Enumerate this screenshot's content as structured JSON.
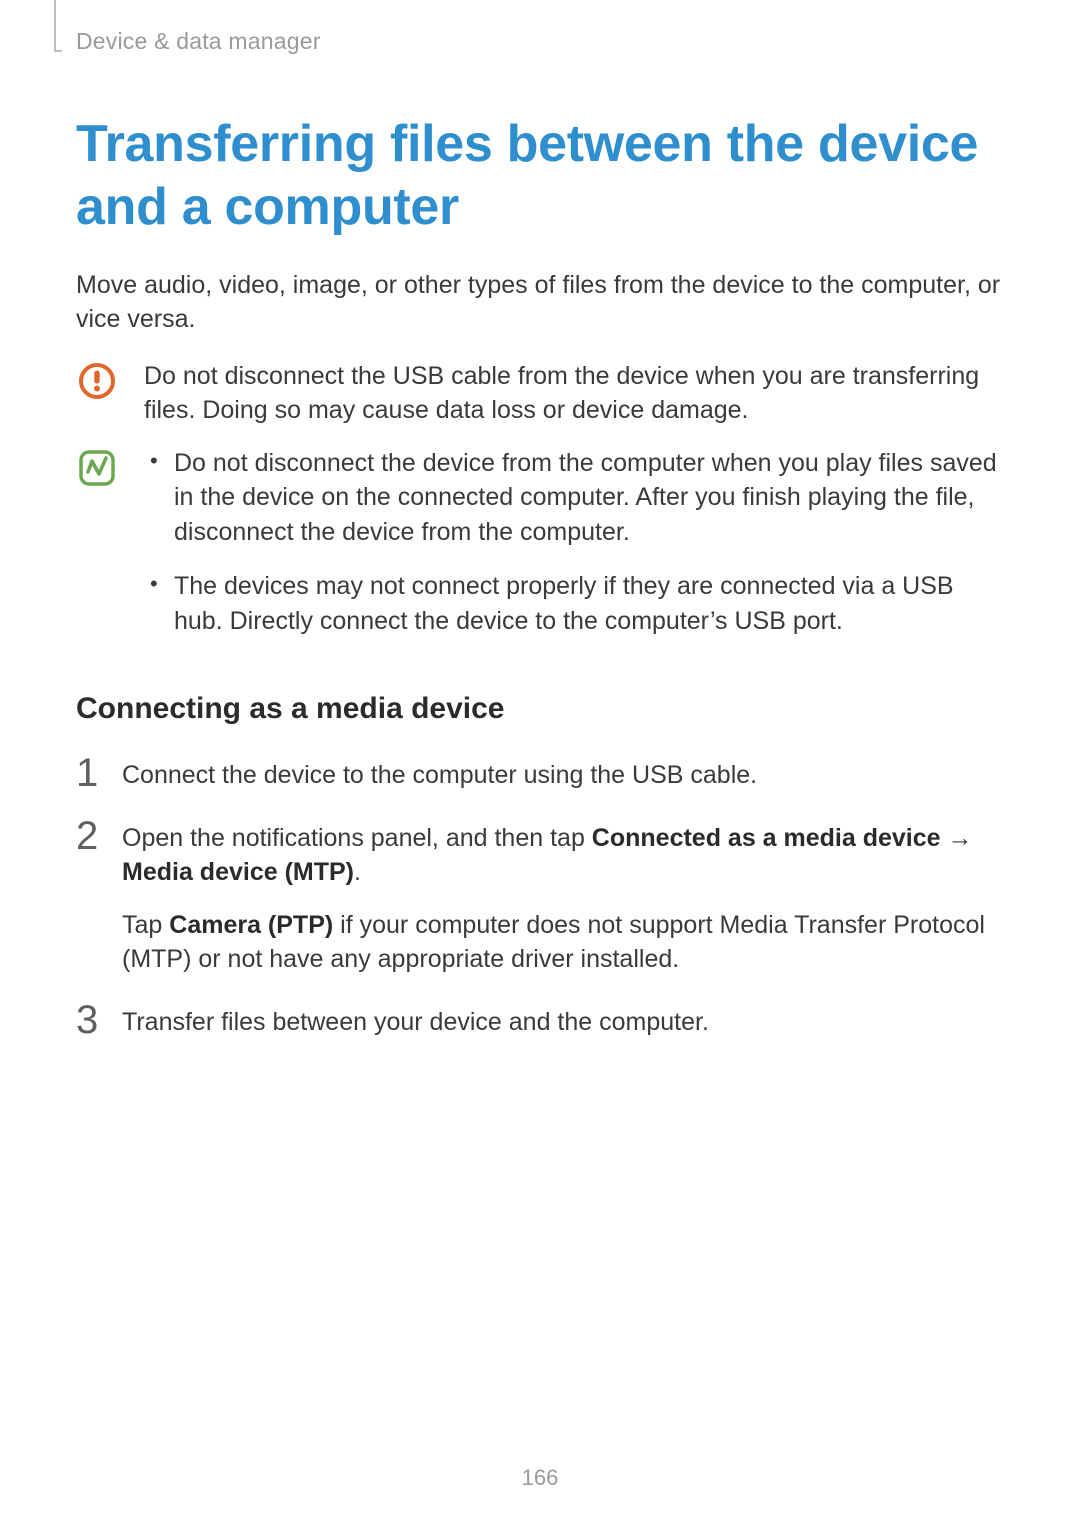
{
  "breadcrumb": "Device & data manager",
  "title": "Transferring files between the device and a computer",
  "intro": "Move audio, video, image, or other types of files from the device to the computer, or vice versa.",
  "caution": {
    "text": "Do not disconnect the USB cable from the device when you are transferring files. Doing so may cause data loss or device damage."
  },
  "info": {
    "bullets": [
      "Do not disconnect the device from the computer when you play files saved in the device on the connected computer. After you finish playing the file, disconnect the device from the computer.",
      "The devices may not connect properly if they are connected via a USB hub. Directly connect the device to the computer’s USB port."
    ]
  },
  "subhead": "Connecting as a media device",
  "steps": {
    "s1_num": "1",
    "s1_text": "Connect the device to the computer using the USB cable.",
    "s2_num": "2",
    "s2_pre": "Open the notifications panel, and then tap ",
    "s2_b1": "Connected as a media device",
    "s2_arrow": " → ",
    "s2_b2": "Media device (MTP)",
    "s2_post": ".",
    "s2_line2_pre": "Tap ",
    "s2_line2_b": "Camera (PTP)",
    "s2_line2_post": " if your computer does not support Media Transfer Protocol (MTP) or not have any appropriate driver installed.",
    "s3_num": "3",
    "s3_text": "Transfer files between your device and the computer."
  },
  "page_number": "166"
}
